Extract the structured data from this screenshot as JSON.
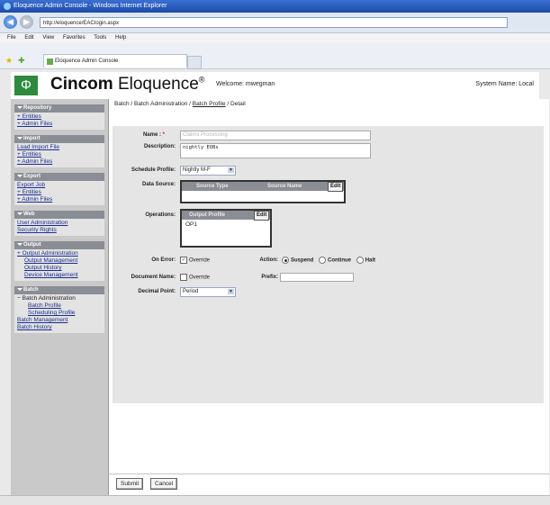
{
  "browser": {
    "title": "Eloquence Admin Console - Windows Internet Explorer",
    "address": "http://eloquence/EACIogin.aspx",
    "menu": [
      "File",
      "Edit",
      "View",
      "Favorites",
      "Tools",
      "Help"
    ],
    "tab_label": "Eloquence Admin Console"
  },
  "header": {
    "brand_cincom": "Cincom",
    "brand_eloquence": "Eloquence",
    "brand_mark": "®",
    "logo_glyph": "Φ",
    "welcome": "Welcome: mwegman",
    "system_name": "System Name: Local"
  },
  "sidebar": {
    "repository": {
      "title": "Repository",
      "items": [
        "Entities",
        "Admin Files"
      ]
    },
    "import": {
      "title": "Import",
      "items": [
        "Load Import File",
        "Entities",
        "Admin Files"
      ]
    },
    "export": {
      "title": "Export",
      "items": [
        "Export Job",
        "Entities",
        "Admin Files"
      ]
    },
    "web": {
      "title": "Web",
      "items": [
        "User Administration",
        "Security Rights"
      ]
    },
    "output": {
      "title": "Output",
      "items": [
        "Output Administration",
        "Output Management",
        "Output History",
        "Device Management"
      ]
    },
    "batch": {
      "title": "Batch",
      "items": [
        "Batch Administration",
        "Batch Profile",
        "Scheduling Profile",
        "Batch Management",
        "Batch History"
      ]
    }
  },
  "breadcrumb": {
    "part1": "Batch",
    "sep1": " / ",
    "part2": "Batch Administration",
    "sep2": " / ",
    "part3": "Batch Profile",
    "sep3": " / ",
    "part4": "Detail"
  },
  "form": {
    "name_label": "Name :",
    "name_required": "*",
    "name_placeholder": "Claims Processing",
    "description_label": "Description:",
    "description_value": "nightly EOBs",
    "schedule_label": "Schedule Profile:",
    "schedule_value": "Nightly M-F",
    "datasource_label": "Data Source:",
    "datasource_columns": [
      "Source Type",
      "Source Name"
    ],
    "datasource_edit": "Edit",
    "operations_label": "Operations:",
    "operations_column": "Output Profile",
    "operations_edit": "Edit",
    "operations_rows": [
      "OP1"
    ],
    "onerror_label": "On Error:",
    "onerror_override": "Override",
    "action_label": "Action:",
    "action_options": [
      "Suspend",
      "Continue",
      "Halt"
    ],
    "document_label": "Document Name:",
    "document_override": "Override",
    "prefix_label": "Prefix:",
    "decimal_label": "Decimal Point:",
    "decimal_value": "Period"
  },
  "footer": {
    "submit": "Submit",
    "cancel": "Cancel"
  }
}
